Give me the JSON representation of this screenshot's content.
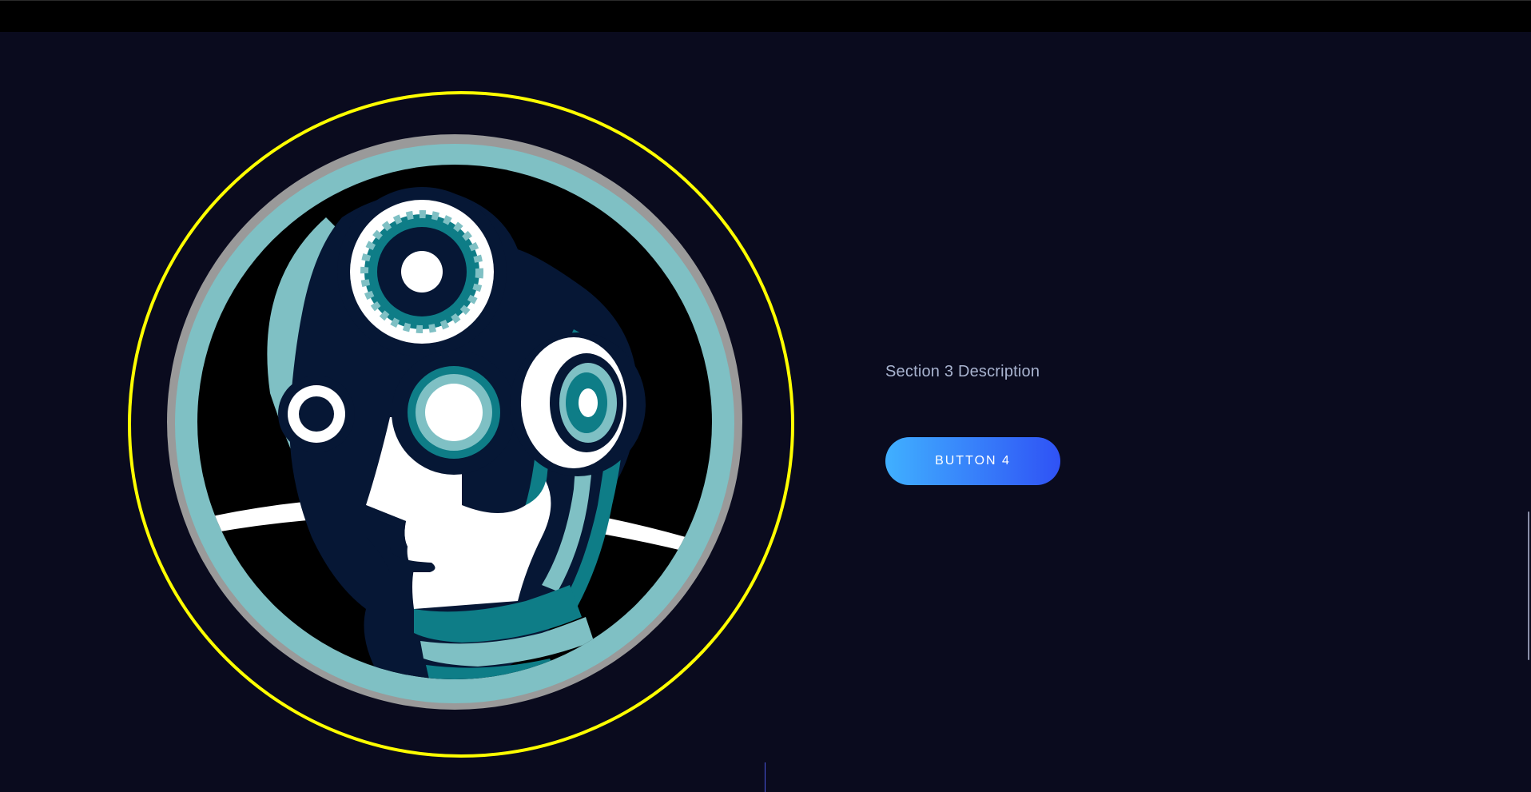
{
  "section": {
    "description": "Section 3 Description",
    "button_label": "BUTTON 4"
  },
  "colors": {
    "background": "#0a0b1e",
    "topbar": "#000000",
    "ring": "#ffff00",
    "logo_teal": "#7fc0c4",
    "logo_navy": "#061735",
    "button_gradient_start": "#40b0ff",
    "button_gradient_end": "#2f52f5",
    "description_text": "#a9b4d0"
  },
  "logo": {
    "icon": "robot-head-gears-logo"
  }
}
